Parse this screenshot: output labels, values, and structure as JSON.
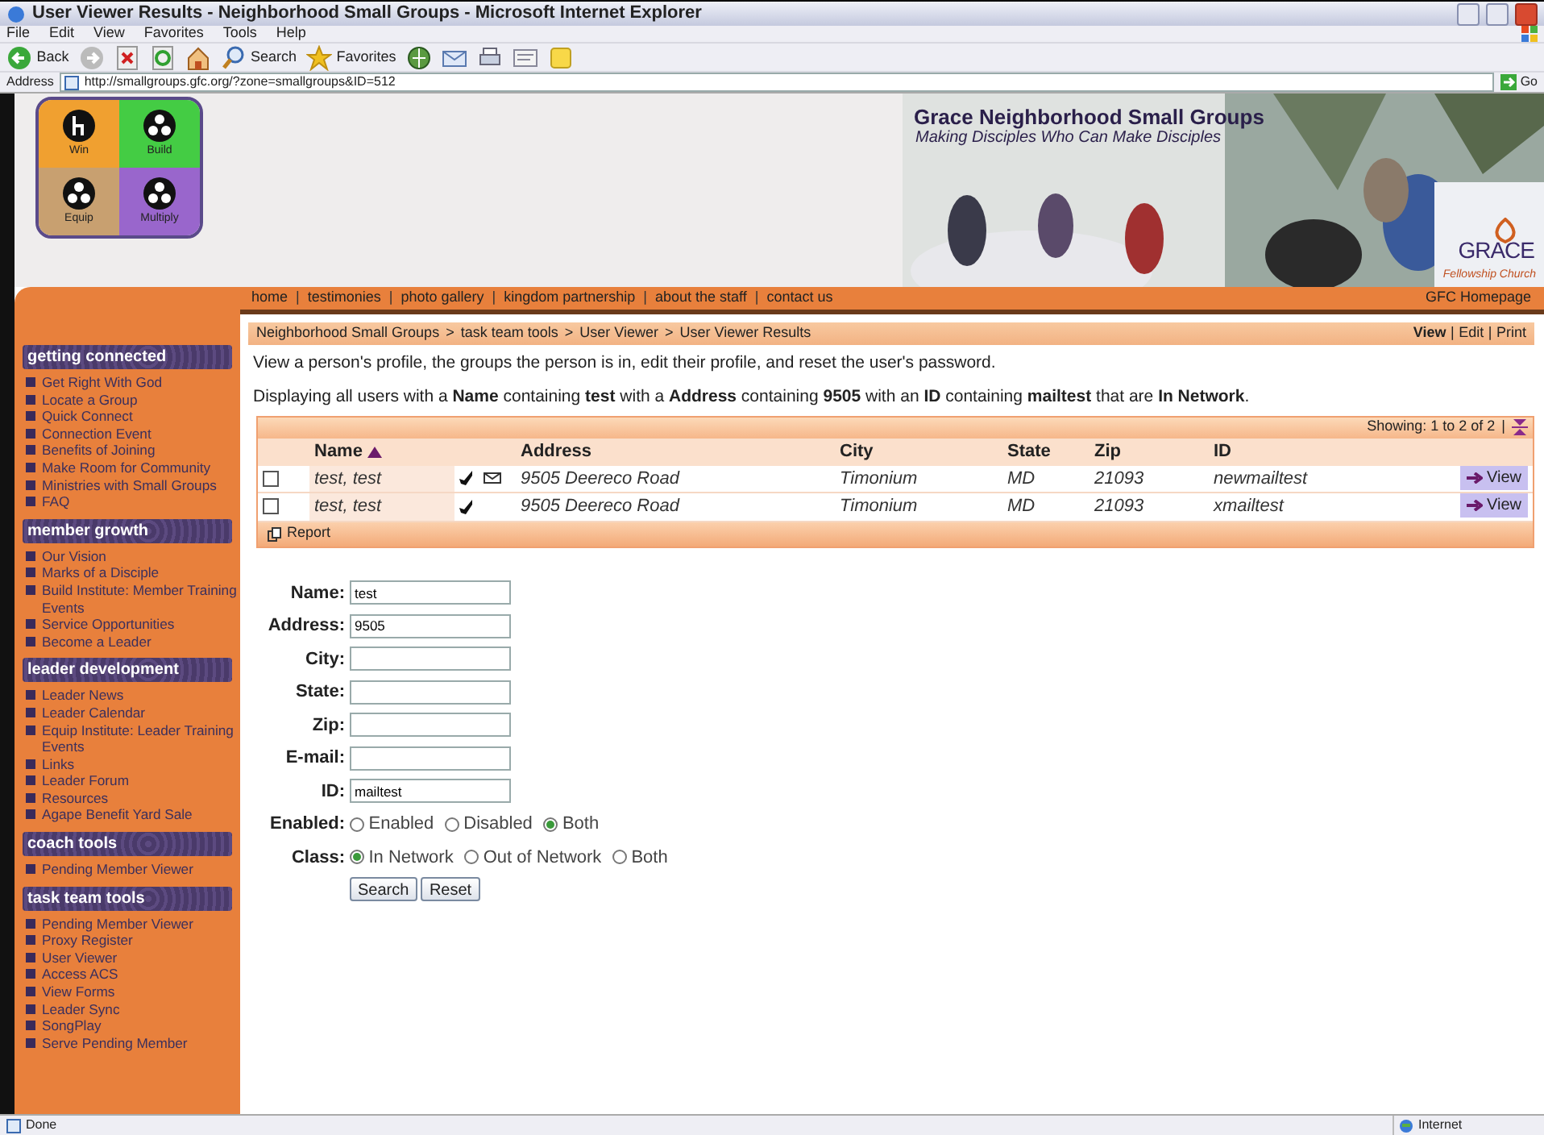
{
  "window": {
    "title": "User Viewer Results - Neighborhood Small Groups - Microsoft Internet Explorer"
  },
  "menu": [
    "File",
    "Edit",
    "View",
    "Favorites",
    "Tools",
    "Help"
  ],
  "toolbar": [
    {
      "kind": "back",
      "label": "Back"
    },
    {
      "kind": "forward"
    },
    {
      "kind": "stop"
    },
    {
      "kind": "refresh"
    },
    {
      "kind": "home"
    },
    {
      "kind": "search",
      "label": "Search"
    },
    {
      "kind": "favorites",
      "label": "Favorites"
    },
    {
      "kind": "media"
    },
    {
      "kind": "mail"
    },
    {
      "kind": "print"
    },
    {
      "kind": "edit"
    },
    {
      "kind": "note"
    }
  ],
  "address": {
    "label": "Address",
    "url": "http://smallgroups.gfc.org/?zone=smallgroups&ID=512",
    "go": "Go"
  },
  "header": {
    "tiles": [
      {
        "label": "Win",
        "color": "#f0a030"
      },
      {
        "label": "Build",
        "color": "#44cc44"
      },
      {
        "label": "Equip",
        "color": "#c8a070"
      },
      {
        "label": "Multiply",
        "color": "#9966cc"
      }
    ],
    "title": "Grace Neighborhood Small Groups",
    "tagline": "Making Disciples Who Can Make Disciples",
    "church": "GRACE",
    "church_sub": "Fellowship Church"
  },
  "nav": {
    "separator": "|",
    "links": [
      "home",
      "testimonies",
      "photo gallery",
      "kingdom partnership",
      "about the staff",
      "contact us"
    ],
    "right": "GFC Homepage"
  },
  "sidebar": [
    {
      "title": "getting connected",
      "items": [
        "Get Right With God",
        "Locate a Group",
        "Quick Connect",
        "Connection Event",
        "Benefits of Joining",
        "Make Room for Community",
        "Ministries with Small Groups",
        "FAQ"
      ]
    },
    {
      "title": "member growth",
      "items": [
        "Our Vision",
        "Marks of a Disciple",
        "Build Institute: Member Training Events",
        "Service Opportunities",
        "Become a Leader"
      ]
    },
    {
      "title": "leader development",
      "items": [
        "Leader News",
        "Leader Calendar",
        "Equip Institute: Leader Training Events",
        "Links",
        "Leader Forum",
        "Resources",
        "Agape Benefit Yard Sale"
      ]
    },
    {
      "title": "coach tools",
      "items": [
        "Pending Member Viewer"
      ]
    },
    {
      "title": "task team tools",
      "items": [
        "Pending Member Viewer",
        "Proxy Register",
        "User Viewer",
        "Access ACS",
        "View Forms",
        "Leader Sync",
        "SongPlay",
        "Serve Pending Member"
      ]
    }
  ],
  "breadcrumb_separator": ">",
  "view_separator": "|",
  "breadcrumb": [
    "Neighborhood Small Groups",
    "task team tools",
    "User Viewer",
    "User Viewer Results"
  ],
  "view_actions": [
    {
      "label": "View",
      "selected": true
    },
    {
      "label": "Edit",
      "selected": false
    },
    {
      "label": "Print",
      "selected": false
    }
  ],
  "description": "View a person's profile, the groups the person is in, edit their profile, and reset the user's password.",
  "filter_summary": "Displaying all users with a **Name** containing **test** with a **Address** containing **9505** with an **ID** containing **mailtest** that are **In Network**.",
  "table": {
    "showing": "Showing: 1 to 2 of 2",
    "showing_separator": "|",
    "columns": [
      {
        "label": "Name",
        "sorted": true
      },
      {
        "label": "Address",
        "sorted": false
      },
      {
        "label": "City",
        "sorted": false
      },
      {
        "label": "State",
        "sorted": false
      },
      {
        "label": "Zip",
        "sorted": false
      },
      {
        "label": "ID",
        "sorted": false
      }
    ],
    "rows": [
      {
        "checked": false,
        "name": "test, test",
        "phone": true,
        "email": true,
        "address": "9505 Deereco Road",
        "city": "Timonium",
        "state": "MD",
        "zip": "21093",
        "id": "newmailtest",
        "action": "View"
      },
      {
        "checked": false,
        "name": "test, test",
        "phone": true,
        "email": false,
        "address": "9505 Deereco Road",
        "city": "Timonium",
        "state": "MD",
        "zip": "21093",
        "id": "xmailtest",
        "action": "View"
      }
    ],
    "footer": "Report"
  },
  "form": {
    "fields": [
      {
        "label": "Name:",
        "value": "test"
      },
      {
        "label": "Address:",
        "value": "9505"
      },
      {
        "label": "City:"
      },
      {
        "label": "State:"
      },
      {
        "label": "Zip:"
      },
      {
        "label": "E-mail:"
      },
      {
        "label": "ID:",
        "value": "mailtest"
      }
    ],
    "radios": [
      {
        "label": "Enabled:",
        "options": [
          {
            "label": "Enabled",
            "selected": false
          },
          {
            "label": "Disabled",
            "selected": false
          },
          {
            "label": "Both",
            "selected": true
          }
        ]
      },
      {
        "label": "Class:",
        "options": [
          {
            "label": "In Network",
            "selected": true
          },
          {
            "label": "Out of Network",
            "selected": false
          },
          {
            "label": "Both",
            "selected": false
          }
        ]
      }
    ],
    "buttons": [
      "Search",
      "Reset"
    ]
  },
  "status": {
    "text": "Done",
    "zone": "Internet"
  }
}
